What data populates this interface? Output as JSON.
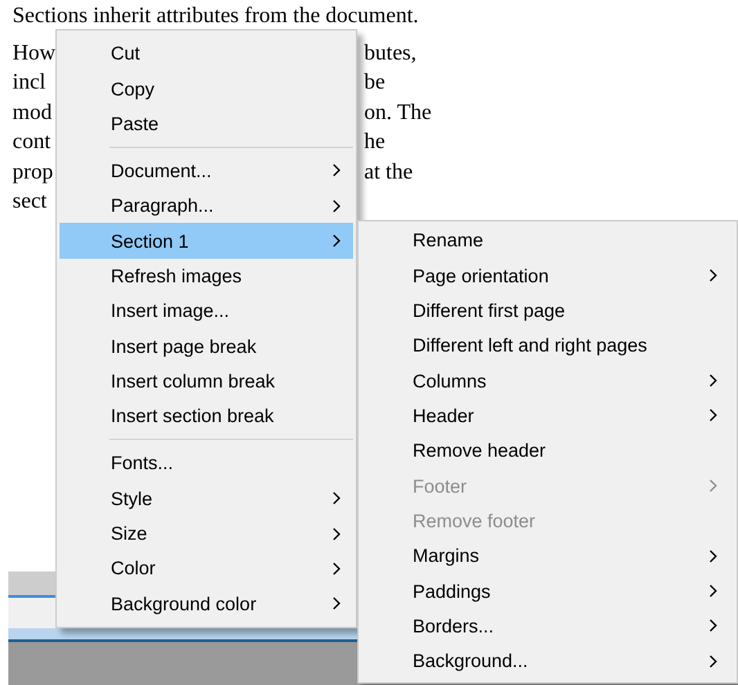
{
  "document": {
    "lines": [
      {
        "left": "Sections inherit attributes from the document."
      },
      {
        "left": "How",
        "right": "butes,"
      },
      {
        "left": "incl",
        "right": "be"
      },
      {
        "left": "mod",
        "right": "on. The"
      },
      {
        "left": "cont",
        "right": "he"
      },
      {
        "left": "prop",
        "right": "at the"
      },
      {
        "left": "sect"
      }
    ]
  },
  "context_menu": {
    "items": [
      {
        "kind": "item",
        "label": "Cut",
        "submenu": false,
        "selected": false,
        "disabled": false
      },
      {
        "kind": "item",
        "label": "Copy",
        "submenu": false,
        "selected": false,
        "disabled": false
      },
      {
        "kind": "item",
        "label": "Paste",
        "submenu": false,
        "selected": false,
        "disabled": false
      },
      {
        "kind": "separator"
      },
      {
        "kind": "item",
        "label": "Document...",
        "submenu": true,
        "selected": false,
        "disabled": false
      },
      {
        "kind": "item",
        "label": "Paragraph...",
        "submenu": true,
        "selected": false,
        "disabled": false
      },
      {
        "kind": "item",
        "label": "Section 1",
        "submenu": true,
        "selected": true,
        "disabled": false
      },
      {
        "kind": "item",
        "label": "Refresh images",
        "submenu": false,
        "selected": false,
        "disabled": false
      },
      {
        "kind": "item",
        "label": "Insert image...",
        "submenu": false,
        "selected": false,
        "disabled": false
      },
      {
        "kind": "item",
        "label": "Insert page break",
        "submenu": false,
        "selected": false,
        "disabled": false
      },
      {
        "kind": "item",
        "label": "Insert column break",
        "submenu": false,
        "selected": false,
        "disabled": false
      },
      {
        "kind": "item",
        "label": "Insert section break",
        "submenu": false,
        "selected": false,
        "disabled": false
      },
      {
        "kind": "separator"
      },
      {
        "kind": "item",
        "label": "Fonts...",
        "submenu": false,
        "selected": false,
        "disabled": false
      },
      {
        "kind": "item",
        "label": "Style",
        "submenu": true,
        "selected": false,
        "disabled": false
      },
      {
        "kind": "item",
        "label": "Size",
        "submenu": true,
        "selected": false,
        "disabled": false
      },
      {
        "kind": "item",
        "label": "Color",
        "submenu": true,
        "selected": false,
        "disabled": false
      },
      {
        "kind": "item",
        "label": "Background color",
        "submenu": true,
        "selected": false,
        "disabled": false
      }
    ]
  },
  "section_submenu": {
    "items": [
      {
        "kind": "item",
        "label": "Rename",
        "submenu": false,
        "selected": false,
        "disabled": false
      },
      {
        "kind": "item",
        "label": "Page orientation",
        "submenu": true,
        "selected": false,
        "disabled": false
      },
      {
        "kind": "item",
        "label": "Different first page",
        "submenu": false,
        "selected": false,
        "disabled": false
      },
      {
        "kind": "item",
        "label": "Different left and right pages",
        "submenu": false,
        "selected": false,
        "disabled": false
      },
      {
        "kind": "item",
        "label": "Columns",
        "submenu": true,
        "selected": false,
        "disabled": false
      },
      {
        "kind": "item",
        "label": "Header",
        "submenu": true,
        "selected": false,
        "disabled": false
      },
      {
        "kind": "item",
        "label": "Remove header",
        "submenu": false,
        "selected": false,
        "disabled": false
      },
      {
        "kind": "item",
        "label": "Footer",
        "submenu": true,
        "selected": false,
        "disabled": true
      },
      {
        "kind": "item",
        "label": "Remove footer",
        "submenu": false,
        "selected": false,
        "disabled": true
      },
      {
        "kind": "item",
        "label": "Margins",
        "submenu": true,
        "selected": false,
        "disabled": false
      },
      {
        "kind": "item",
        "label": "Paddings",
        "submenu": true,
        "selected": false,
        "disabled": false
      },
      {
        "kind": "item",
        "label": "Borders...",
        "submenu": true,
        "selected": false,
        "disabled": false
      },
      {
        "kind": "item",
        "label": "Background...",
        "submenu": true,
        "selected": false,
        "disabled": false
      }
    ]
  }
}
